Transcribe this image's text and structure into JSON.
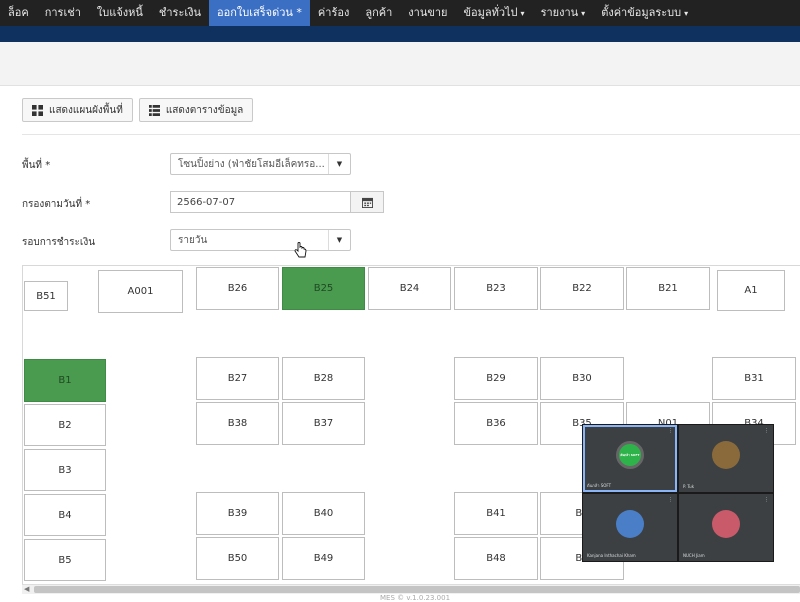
{
  "nav": {
    "items": [
      {
        "label": "ล็อค",
        "dropdown": false,
        "active": false
      },
      {
        "label": "การเช่า",
        "dropdown": false,
        "active": false
      },
      {
        "label": "ใบแจ้งหนี้",
        "dropdown": false,
        "active": false
      },
      {
        "label": "ชำระเงิน",
        "dropdown": false,
        "active": false
      },
      {
        "label": "ออกใบเสร็จด่วน *",
        "dropdown": false,
        "active": true
      },
      {
        "label": "ค่าร้อง",
        "dropdown": false,
        "active": false
      },
      {
        "label": "ลูกค้า",
        "dropdown": false,
        "active": false
      },
      {
        "label": "งานขาย",
        "dropdown": false,
        "active": false
      },
      {
        "label": "ข้อมูลทั่วไป",
        "dropdown": true,
        "active": false
      },
      {
        "label": "รายงาน",
        "dropdown": true,
        "active": false
      },
      {
        "label": "ตั้งค่าข้อมูลระบบ",
        "dropdown": true,
        "active": false
      }
    ],
    "caret": "▾"
  },
  "toolbar": {
    "show_map_label": "แสดงแผนผังพื้นที่",
    "show_table_label": "แสดงตารางข้อมูล"
  },
  "filters": {
    "area_label": "พื้นที่ *",
    "area_value": "โซนปิ้งย่าง (ฟ่าชัยโสมอีเล็คทรอ...",
    "date_label": "กรองตามวันที่ *",
    "date_value": "2566-07-07",
    "cycle_label": "รอบการชำระเงิน",
    "cycle_value": "รายวัน"
  },
  "colors": {
    "occupied": "#4a9a4f",
    "nav_active": "#3b6fc4",
    "nav_bg": "#222222",
    "blue_strip": "#0f3160"
  },
  "stalls": [
    {
      "label": "B51",
      "occupied": false
    },
    {
      "label": "A001",
      "occupied": false
    },
    {
      "label": "B26",
      "occupied": false
    },
    {
      "label": "B25",
      "occupied": true
    },
    {
      "label": "B24",
      "occupied": false
    },
    {
      "label": "B23",
      "occupied": false
    },
    {
      "label": "B22",
      "occupied": false
    },
    {
      "label": "B21",
      "occupied": false
    },
    {
      "label": "A1",
      "occupied": false
    },
    {
      "label": "B1",
      "occupied": true
    },
    {
      "label": "B27",
      "occupied": false
    },
    {
      "label": "B28",
      "occupied": false
    },
    {
      "label": "B29",
      "occupied": false
    },
    {
      "label": "B30",
      "occupied": false
    },
    {
      "label": "B31",
      "occupied": false
    },
    {
      "label": "B2",
      "occupied": false
    },
    {
      "label": "B38",
      "occupied": false
    },
    {
      "label": "B37",
      "occupied": false
    },
    {
      "label": "B36",
      "occupied": false
    },
    {
      "label": "B35",
      "occupied": false
    },
    {
      "label": "N01",
      "occupied": false
    },
    {
      "label": "B34",
      "occupied": false
    },
    {
      "label": "B3",
      "occupied": false
    },
    {
      "label": "B4",
      "occupied": false
    },
    {
      "label": "B39",
      "occupied": false
    },
    {
      "label": "B40",
      "occupied": false
    },
    {
      "label": "B41",
      "occupied": false
    },
    {
      "label": "B4",
      "occupied": false
    },
    {
      "label": "B5",
      "occupied": false
    },
    {
      "label": "B50",
      "occupied": false
    },
    {
      "label": "B49",
      "occupied": false
    },
    {
      "label": "B48",
      "occupied": false
    },
    {
      "label": "B4",
      "occupied": false
    }
  ],
  "footer_text": "MES © v.1.0.23.001",
  "video_call": {
    "participants": [
      {
        "name": "ต้นกล้า SOFT",
        "avatar": "logo",
        "color": "#2db34a",
        "speaking": true
      },
      {
        "name": "P. Tuk",
        "avatar": "photo",
        "color": "#8a6a3a",
        "speaking": false
      },
      {
        "name": "Kanjana Inthachai Kham",
        "avatar": "person",
        "color": "#4a7fc8",
        "speaking": false
      },
      {
        "name": "NUCH Jiam",
        "avatar": "person",
        "color": "#c85a6a",
        "speaking": false
      }
    ],
    "logo_text": "ต้นกล้า SOFT"
  }
}
